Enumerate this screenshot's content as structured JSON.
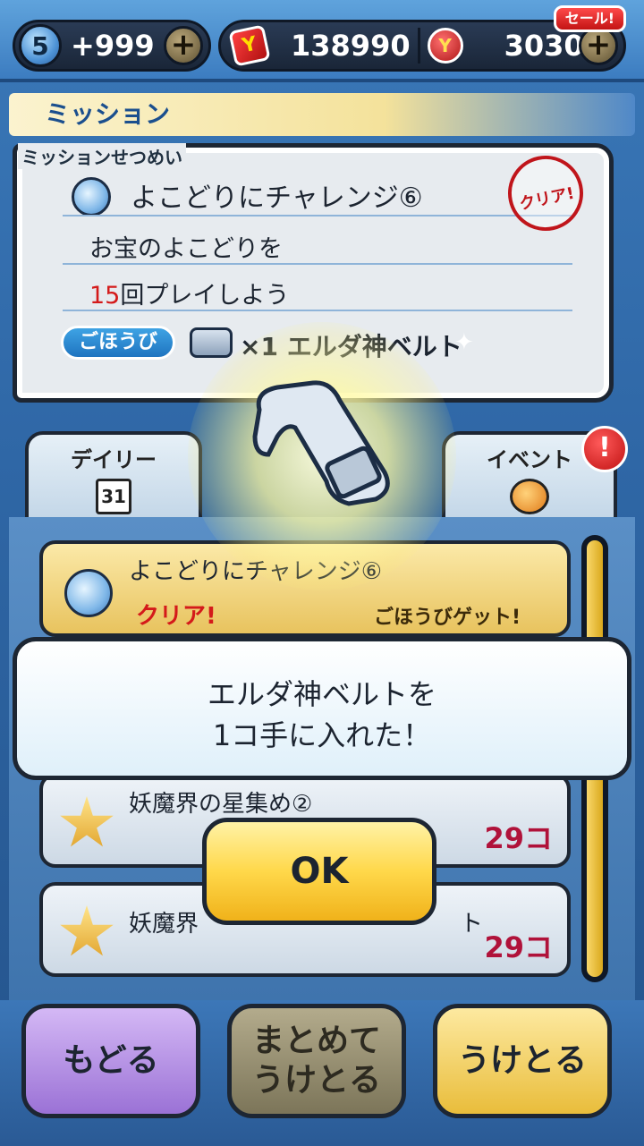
{
  "topbar": {
    "spirit_level": "5",
    "spirit_count": "+999",
    "coins": "138990",
    "money": "30302",
    "sale_label": "セール!",
    "plus_glyph": "+"
  },
  "mission": {
    "header": "ミッション",
    "section_label": "ミッションせつめい",
    "title": "よこどりにチャレンジ⑥",
    "desc_line1": "お宝のよこどりを",
    "desc_count": "15",
    "desc_line2_rest": "回プレイしよう",
    "clear_stamp": "クリア!",
    "reward_label": "ごほうび",
    "reward_text": "×1 エルダ神ベルト"
  },
  "tabs": {
    "daily": "デイリー",
    "daily_date": "31",
    "event": "イベント",
    "alert": "!"
  },
  "list": {
    "items": [
      {
        "title": "よこどりにチャレンジ⑥",
        "status": "クリア!",
        "reward": "ごほうびゲット!"
      },
      {
        "title": "妖魔界の星集め②",
        "count": "29コ"
      },
      {
        "title": "妖魔界",
        "title_tail": "ト",
        "count": "29コ"
      }
    ]
  },
  "dialog": {
    "line1": "エルダ神ベルトを",
    "line2": "1コ手に入れた！",
    "ok": "OK"
  },
  "buttons": {
    "back": "もどる",
    "receive_all_1": "まとめて",
    "receive_all_2": "うけとる",
    "receive": "うけとる"
  },
  "colors": {
    "accent_red": "#d41a1a",
    "ok_yellow": "#ffd84a",
    "back_purple": "#9b72d6"
  }
}
